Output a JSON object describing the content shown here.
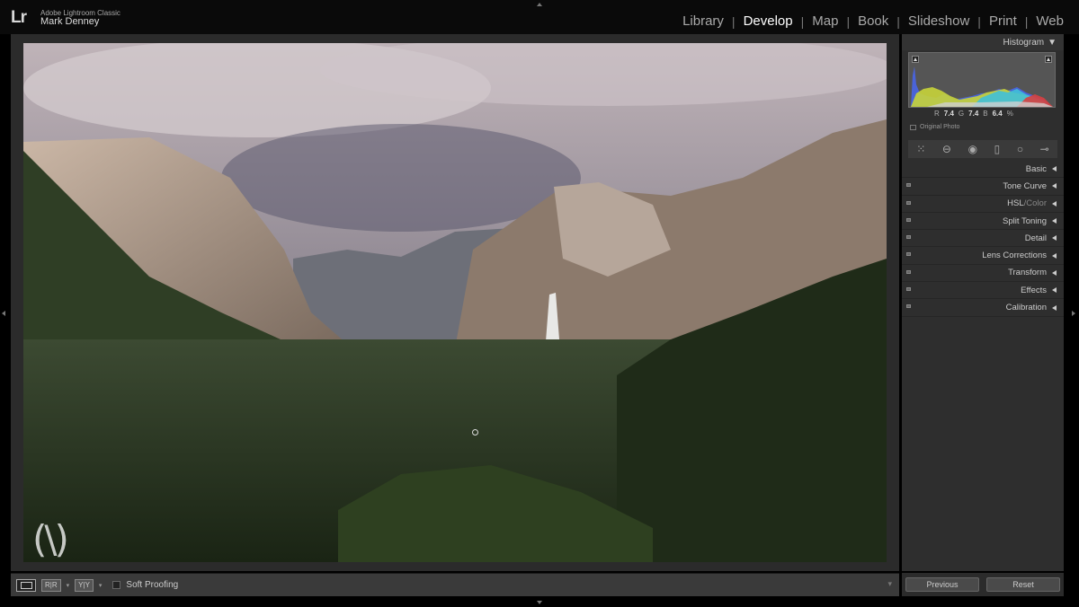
{
  "app": {
    "logo": "Lr",
    "product": "Adobe Lightroom Classic",
    "user": "Mark Denney"
  },
  "modules": [
    {
      "label": "Library",
      "active": false
    },
    {
      "label": "Develop",
      "active": true
    },
    {
      "label": "Map",
      "active": false
    },
    {
      "label": "Book",
      "active": false
    },
    {
      "label": "Slideshow",
      "active": false
    },
    {
      "label": "Print",
      "active": false
    },
    {
      "label": "Web",
      "active": false
    }
  ],
  "module_separator": "|",
  "histogram": {
    "title": "Histogram",
    "collapse_icon": "▼",
    "readout": {
      "r_label": "R",
      "r_value": "7.4",
      "g_label": "G",
      "g_value": "7.4",
      "b_label": "B",
      "b_value": "6.4",
      "unit": "%"
    },
    "original_photo": "Original Photo"
  },
  "tools": [
    "grid-icon",
    "crop-icon",
    "spot-removal-icon",
    "red-eye-icon",
    "graduated-filter-icon",
    "radial-filter-icon",
    "adjustment-brush-icon"
  ],
  "panels": [
    {
      "label": "Basic",
      "switch": false
    },
    {
      "label": "Tone Curve",
      "switch": true
    },
    {
      "label": "HSL",
      "label2": " / ",
      "label3": "Color",
      "switch": true
    },
    {
      "label": "Split Toning",
      "switch": true
    },
    {
      "label": "Detail",
      "switch": true
    },
    {
      "label": "Lens Corrections",
      "switch": true
    },
    {
      "label": "Transform",
      "switch": true
    },
    {
      "label": "Effects",
      "switch": true
    },
    {
      "label": "Calibration",
      "switch": true
    }
  ],
  "toolbar": {
    "compare_label": "R|R",
    "survey_label": "Y|Y",
    "soft_proofing": "Soft Proofing"
  },
  "buttons": {
    "previous": "Previous",
    "reset": "Reset"
  },
  "watermark": "(\\)",
  "colors": {
    "background": "#000000",
    "panel": "#2e2e2e",
    "active_module": "#ffffff"
  }
}
